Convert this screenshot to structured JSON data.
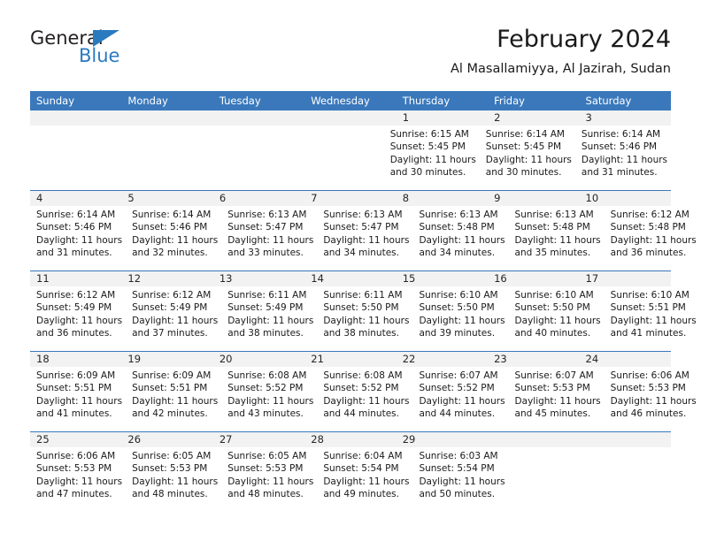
{
  "logo": {
    "word_top": "General",
    "word_bottom": "Blue",
    "triangle_icon": "triangle-icon",
    "blue": "#2a7ac0"
  },
  "header": {
    "title": "February 2024",
    "subtitle": "Al Masallamiyya, Al Jazirah, Sudan"
  },
  "colors": {
    "header_blue": "#3a78bb",
    "daynum_band": "#f2f2f2",
    "text": "#1a1a1a"
  },
  "weekdays": [
    "Sunday",
    "Monday",
    "Tuesday",
    "Wednesday",
    "Thursday",
    "Friday",
    "Saturday"
  ],
  "weeks": [
    [
      {
        "day": "",
        "lines": []
      },
      {
        "day": "",
        "lines": []
      },
      {
        "day": "",
        "lines": []
      },
      {
        "day": "",
        "lines": []
      },
      {
        "day": "1",
        "lines": [
          "Sunrise: 6:15 AM",
          "Sunset: 5:45 PM",
          "Daylight: 11 hours",
          "and 30 minutes."
        ]
      },
      {
        "day": "2",
        "lines": [
          "Sunrise: 6:14 AM",
          "Sunset: 5:45 PM",
          "Daylight: 11 hours",
          "and 30 minutes."
        ]
      },
      {
        "day": "3",
        "lines": [
          "Sunrise: 6:14 AM",
          "Sunset: 5:46 PM",
          "Daylight: 11 hours",
          "and 31 minutes."
        ]
      }
    ],
    [
      {
        "day": "4",
        "lines": [
          "Sunrise: 6:14 AM",
          "Sunset: 5:46 PM",
          "Daylight: 11 hours",
          "and 31 minutes."
        ]
      },
      {
        "day": "5",
        "lines": [
          "Sunrise: 6:14 AM",
          "Sunset: 5:46 PM",
          "Daylight: 11 hours",
          "and 32 minutes."
        ]
      },
      {
        "day": "6",
        "lines": [
          "Sunrise: 6:13 AM",
          "Sunset: 5:47 PM",
          "Daylight: 11 hours",
          "and 33 minutes."
        ]
      },
      {
        "day": "7",
        "lines": [
          "Sunrise: 6:13 AM",
          "Sunset: 5:47 PM",
          "Daylight: 11 hours",
          "and 34 minutes."
        ]
      },
      {
        "day": "8",
        "lines": [
          "Sunrise: 6:13 AM",
          "Sunset: 5:48 PM",
          "Daylight: 11 hours",
          "and 34 minutes."
        ]
      },
      {
        "day": "9",
        "lines": [
          "Sunrise: 6:13 AM",
          "Sunset: 5:48 PM",
          "Daylight: 11 hours",
          "and 35 minutes."
        ]
      },
      {
        "day": "10",
        "lines": [
          "Sunrise: 6:12 AM",
          "Sunset: 5:48 PM",
          "Daylight: 11 hours",
          "and 36 minutes."
        ]
      }
    ],
    [
      {
        "day": "11",
        "lines": [
          "Sunrise: 6:12 AM",
          "Sunset: 5:49 PM",
          "Daylight: 11 hours",
          "and 36 minutes."
        ]
      },
      {
        "day": "12",
        "lines": [
          "Sunrise: 6:12 AM",
          "Sunset: 5:49 PM",
          "Daylight: 11 hours",
          "and 37 minutes."
        ]
      },
      {
        "day": "13",
        "lines": [
          "Sunrise: 6:11 AM",
          "Sunset: 5:49 PM",
          "Daylight: 11 hours",
          "and 38 minutes."
        ]
      },
      {
        "day": "14",
        "lines": [
          "Sunrise: 6:11 AM",
          "Sunset: 5:50 PM",
          "Daylight: 11 hours",
          "and 38 minutes."
        ]
      },
      {
        "day": "15",
        "lines": [
          "Sunrise: 6:10 AM",
          "Sunset: 5:50 PM",
          "Daylight: 11 hours",
          "and 39 minutes."
        ]
      },
      {
        "day": "16",
        "lines": [
          "Sunrise: 6:10 AM",
          "Sunset: 5:50 PM",
          "Daylight: 11 hours",
          "and 40 minutes."
        ]
      },
      {
        "day": "17",
        "lines": [
          "Sunrise: 6:10 AM",
          "Sunset: 5:51 PM",
          "Daylight: 11 hours",
          "and 41 minutes."
        ]
      }
    ],
    [
      {
        "day": "18",
        "lines": [
          "Sunrise: 6:09 AM",
          "Sunset: 5:51 PM",
          "Daylight: 11 hours",
          "and 41 minutes."
        ]
      },
      {
        "day": "19",
        "lines": [
          "Sunrise: 6:09 AM",
          "Sunset: 5:51 PM",
          "Daylight: 11 hours",
          "and 42 minutes."
        ]
      },
      {
        "day": "20",
        "lines": [
          "Sunrise: 6:08 AM",
          "Sunset: 5:52 PM",
          "Daylight: 11 hours",
          "and 43 minutes."
        ]
      },
      {
        "day": "21",
        "lines": [
          "Sunrise: 6:08 AM",
          "Sunset: 5:52 PM",
          "Daylight: 11 hours",
          "and 44 minutes."
        ]
      },
      {
        "day": "22",
        "lines": [
          "Sunrise: 6:07 AM",
          "Sunset: 5:52 PM",
          "Daylight: 11 hours",
          "and 44 minutes."
        ]
      },
      {
        "day": "23",
        "lines": [
          "Sunrise: 6:07 AM",
          "Sunset: 5:53 PM",
          "Daylight: 11 hours",
          "and 45 minutes."
        ]
      },
      {
        "day": "24",
        "lines": [
          "Sunrise: 6:06 AM",
          "Sunset: 5:53 PM",
          "Daylight: 11 hours",
          "and 46 minutes."
        ]
      }
    ],
    [
      {
        "day": "25",
        "lines": [
          "Sunrise: 6:06 AM",
          "Sunset: 5:53 PM",
          "Daylight: 11 hours",
          "and 47 minutes."
        ]
      },
      {
        "day": "26",
        "lines": [
          "Sunrise: 6:05 AM",
          "Sunset: 5:53 PM",
          "Daylight: 11 hours",
          "and 48 minutes."
        ]
      },
      {
        "day": "27",
        "lines": [
          "Sunrise: 6:05 AM",
          "Sunset: 5:53 PM",
          "Daylight: 11 hours",
          "and 48 minutes."
        ]
      },
      {
        "day": "28",
        "lines": [
          "Sunrise: 6:04 AM",
          "Sunset: 5:54 PM",
          "Daylight: 11 hours",
          "and 49 minutes."
        ]
      },
      {
        "day": "29",
        "lines": [
          "Sunrise: 6:03 AM",
          "Sunset: 5:54 PM",
          "Daylight: 11 hours",
          "and 50 minutes."
        ]
      },
      {
        "day": "",
        "lines": []
      },
      {
        "day": "",
        "lines": []
      }
    ]
  ]
}
